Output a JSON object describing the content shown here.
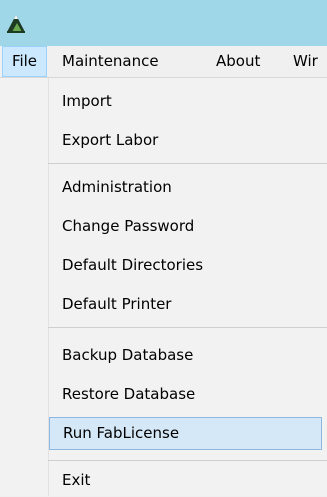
{
  "menubar": {
    "items": [
      {
        "label": "File"
      },
      {
        "label": "Maintenance"
      },
      {
        "label": "About"
      },
      {
        "label": "Wir"
      }
    ]
  },
  "file_menu": {
    "items": [
      {
        "label": "Import"
      },
      {
        "label": "Export Labor"
      },
      {
        "label": "Administration"
      },
      {
        "label": "Change Password"
      },
      {
        "label": "Default Directories"
      },
      {
        "label": "Default Printer"
      },
      {
        "label": "Backup Database"
      },
      {
        "label": "Restore Database"
      },
      {
        "label": "Run FabLicense"
      },
      {
        "label": "Exit"
      }
    ]
  },
  "colors": {
    "titlebar": "#9fd7e8",
    "menu_active": "#cce8ff",
    "menu_highlight": "#d5e8f8"
  }
}
